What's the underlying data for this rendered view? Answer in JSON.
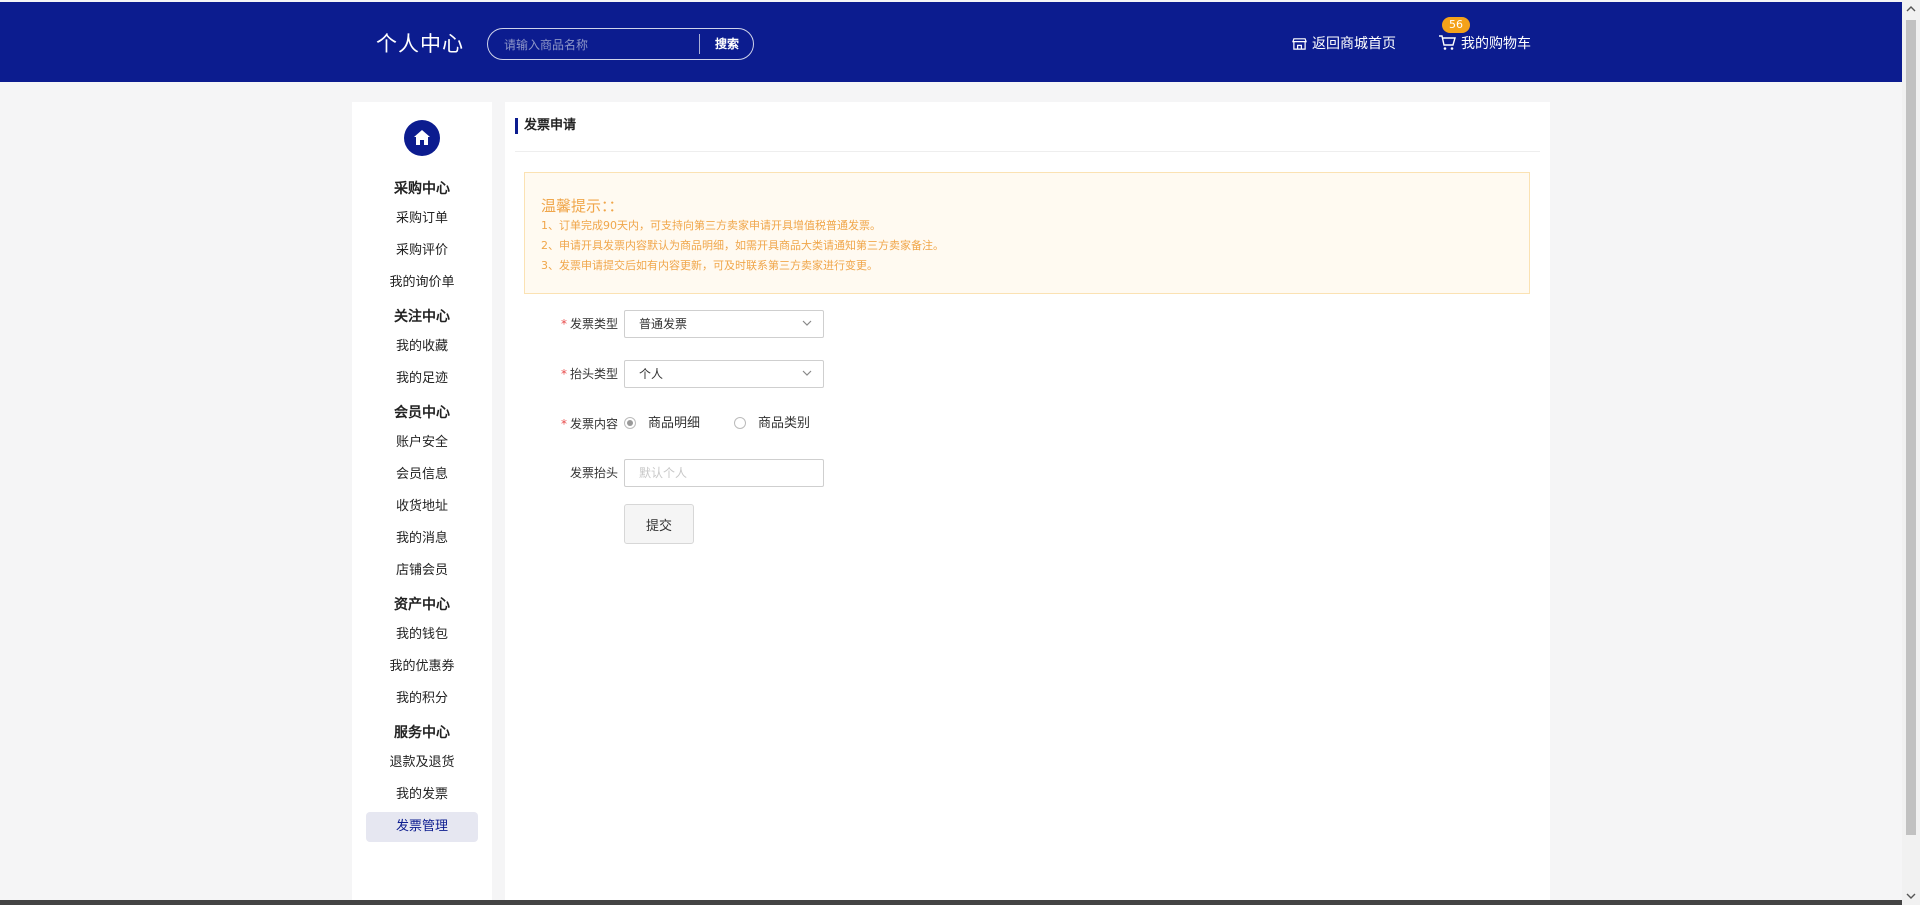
{
  "header": {
    "title": "个人中心",
    "search": {
      "placeholder": "请输入商品名称",
      "button_label": "搜索"
    },
    "home_link": {
      "label": "返回商城首页",
      "icon": "store-icon"
    },
    "cart_link": {
      "label": "我的购物车",
      "badge": "56",
      "icon": "cart-icon"
    }
  },
  "sidebar": {
    "home_icon": "home-icon",
    "groups": [
      {
        "title": "采购中心",
        "items": [
          "采购订单",
          "采购评价",
          "我的询价单"
        ]
      },
      {
        "title": "关注中心",
        "items": [
          "我的收藏",
          "我的足迹"
        ]
      },
      {
        "title": "会员中心",
        "items": [
          "账户安全",
          "会员信息",
          "收货地址",
          "我的消息",
          "店铺会员"
        ]
      },
      {
        "title": "资产中心",
        "items": [
          "我的钱包",
          "我的优惠券",
          "我的积分"
        ]
      },
      {
        "title": "服务中心",
        "items": [
          "退款及退货",
          "我的发票",
          "发票管理"
        ]
      }
    ],
    "active_item": "发票管理"
  },
  "main": {
    "title": "发票申请",
    "notice": {
      "title": "温馨提示：：",
      "lines": [
        "1、订单完成90天内，可支持向第三方卖家申请开具增值税普通发票。",
        "2、申请开具发票内容默认为商品明细，如需开具商品大类请通知第三方卖家备注。",
        "3、发票申请提交后如有内容更新，可及时联系第三方卖家进行变更。"
      ]
    },
    "form": {
      "invoice_type": {
        "label": "发票类型",
        "value": "普通发票",
        "required": true
      },
      "title_type": {
        "label": "抬头类型",
        "value": "个人",
        "required": true
      },
      "content": {
        "label": "发票内容",
        "required": true,
        "options": [
          "商品明细",
          "商品类别"
        ],
        "selected": "商品明细"
      },
      "invoice_title": {
        "label": "发票抬头",
        "placeholder": "默认个人",
        "value": ""
      },
      "submit_label": "提交"
    }
  },
  "colors": {
    "primary": "#0c1c8f",
    "notice_text": "#f0a64a",
    "badge": "#f4a21a",
    "required": "#e84a4a"
  }
}
